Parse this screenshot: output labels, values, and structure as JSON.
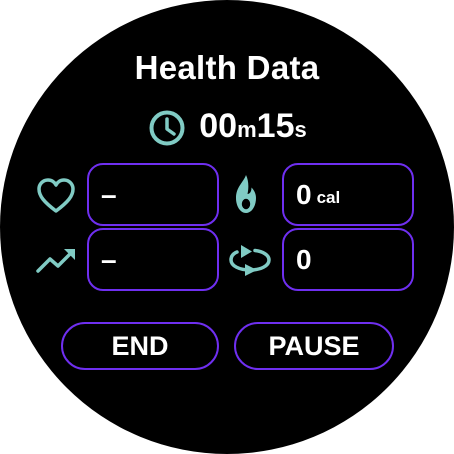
{
  "screen": {
    "title": "Health Data"
  },
  "timer": {
    "icon": "clock-icon",
    "minutes": "00",
    "minutes_unit": "m",
    "seconds": "15",
    "seconds_unit": "s"
  },
  "metrics": {
    "heart_rate": {
      "icon": "heart-icon",
      "value": "–"
    },
    "calories": {
      "icon": "flame-icon",
      "value": "0",
      "unit": "cal"
    },
    "pace": {
      "icon": "trending-up-icon",
      "value": "–"
    },
    "laps": {
      "icon": "laps-icon",
      "value": "0"
    }
  },
  "buttons": {
    "end_label": "END",
    "pause_label": "PAUSE"
  },
  "colors": {
    "background": "#000000",
    "accent_border": "#6f2ff0",
    "icon": "#80cbc4",
    "text": "#ffffff"
  }
}
